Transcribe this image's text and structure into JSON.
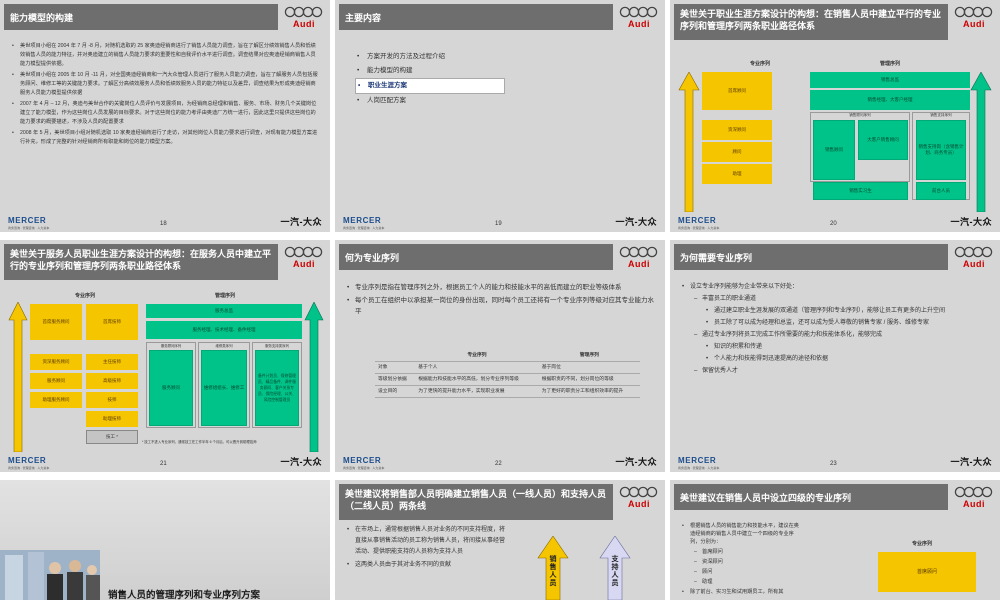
{
  "brand": {
    "mercer": "MERCER",
    "mercer_tagline": "商务咨询 · 管理咨询 · 人力资本",
    "audi": "Audi",
    "vw": "一汽-大众"
  },
  "s18": {
    "title": "能力模型的构建",
    "page": "18",
    "bullets": [
      "美世项目小组在 2004 年 7 月 -8 月，对随机选取的 25 家奥迪经销商进行了销售人员能力调查，旨在了解区分绩效销售人员和低绩效销售人员的能力特征，并对奥迪建立的销售人员能力要求的重要性和自我评价水平进行调查。调查结果对应奥迪经销商销售人员能力模型提供依据。",
      "美世项目小组在 2005 年 10 月 -11 月，对全国奥迪经销商和一汽大众管理人员进行了服务人员能力调查，旨在了解服务人员包括服务顾问、维修工等的关键能力要求。了解区分高绩效服务人员和低绩效服务人员的能力特征以及差异，调查结果为形成奥迪经销商服务人员能力模型提供依据",
      "2007 年 4 月 – 12 月，奥迪与美世合作的关键岗位人员评价与发展项目，为经销商总经理和销售、服务、市场、财务几个关键岗位建立了能力模型，作为这些岗位人员发展的目标要求。对于这些岗位的能力考评由奥迪厂方统一进行，因此这里只提供这些岗位的能力要求的概要描述，不涉及人员的配置要求",
      "2008 年 5 月，美世项目小组对随机选取 10 家奥迪经销商进行了走访，对其他岗位人员能力要求进行调查，对现有能力模型方案进行补充，形成了完整的针对经销商所有职能和岗位的能力模型方案。"
    ]
  },
  "s19": {
    "title": "主要内容",
    "page": "19",
    "items": [
      "方案开发的方法及过程介绍",
      "能力模型的构建",
      "职业生涯方案",
      "人岗匹配方案"
    ]
  },
  "s20": {
    "title": "美世关于职业生涯方案设计的构想：在销售人员中建立平行的专业序列和管理序列两条职业路径体系",
    "page": "20",
    "col_prof": "专业序列",
    "col_mgmt": "管理序列",
    "prof": [
      "首席顾问",
      "资深顾问",
      "顾问",
      "助理"
    ],
    "mgmt_top": [
      "销售总监",
      "销售经理、大客户经理"
    ],
    "grp1": "销售顾问序列",
    "grp2": "销售支持序列",
    "cells": [
      "销售顾问",
      "大客户销售顾问",
      "销售支持岗（含销售计划、商务专员）",
      "销售实习生",
      "前台人员"
    ]
  },
  "s21": {
    "title": "美世关于服务人员职业生涯方案设计的构想：在服务人员中建立平行的专业序列和管理序列两条职业路径体系",
    "page": "21",
    "col_prof": "专业序列",
    "col_mgmt": "管理序列",
    "left": [
      "首席服务顾问",
      "资深服务顾问",
      "服务顾问",
      "助理服务顾问"
    ],
    "right": [
      "首席技师",
      "主任技师",
      "高级技师",
      "技师",
      "助理技师",
      "技工 *"
    ],
    "mgmt_top": [
      "服务总监",
      "服务经理、技术经理、备件经理"
    ],
    "grp": [
      "服务顾问序列",
      "维修类序列",
      "服务支持类序列"
    ],
    "cells": [
      "服务顾问",
      "维修组组长、维修工",
      "备件计划员、保修管理员、精品备件、调件服务顾问、客户关系专员、保险经理、公关、风险控制管理员"
    ],
    "note": "* 技工不进入专业序列，通常技工在工作半年 6 个月后，可以晋升到助理技师"
  },
  "s22": {
    "title": "何为专业序列",
    "page": "22",
    "bullets": [
      "专业序列是指在管理序列之外，根据员工个人的能力和技能水平的高低而建立的职业等级体系",
      "每个员工在组织中以承担某一岗位的身份出现，同时每个员工还将有一个专业序列等级对应其专业能力水平"
    ],
    "table": {
      "headers": [
        "",
        "专业序列",
        "管理序列"
      ],
      "rows": [
        [
          "对象",
          "基于个人",
          "基于岗位"
        ],
        [
          "等级划分依据",
          "根据能力和技能水平的高低，划分专业序列等级",
          "根据职责的不同，划分岗位的等级"
        ],
        [
          "设立目的",
          "为了更快的提升能力水平，实现职业发展",
          "为了更好的职责分工和组织效率的提升"
        ]
      ]
    }
  },
  "s23": {
    "title": "为何需要专业序列",
    "page": "23",
    "lines": [
      {
        "lvl": 1,
        "t": "设立专业序列能够为企业带来以下好处："
      },
      {
        "lvl": 2,
        "t": "丰富员工的职业通道"
      },
      {
        "lvl": 3,
        "t": "通过建立职业生涯发展的双通道（管理序列和专业序列），能够让员工有更多的上升空间"
      },
      {
        "lvl": 3,
        "t": "员工除了可以成为经理和总监，还可以成为受人尊敬的销售专家 / 服务、维修专家"
      },
      {
        "lvl": 2,
        "t": "通过专业序列将员工完成工作所需要的能力和技能体系化，能够完成"
      },
      {
        "lvl": 3,
        "t": "知识的积累和传递"
      },
      {
        "lvl": 3,
        "t": "个人能力和技能得到迅速提高的途径和依据"
      },
      {
        "lvl": 2,
        "t": "保留优秀人才"
      }
    ]
  },
  "s24": {
    "title": "销售人员的管理序列和专业序列方案"
  },
  "s25": {
    "title": "美世建议将销售部人员明确建立销售人员（一线人员）和支持人员（二线人员）两条线",
    "bullets": [
      "在市场上，通常根据销售人员对业务的不同支持程度，将直接从事销售活动的员工称为销售人员，将间接从事经营活动、提供职能支持的人员称为支持人员",
      "这两类人员由于其对业务不同的贡献"
    ],
    "arrow1": "销售人员",
    "arrow2": "支持人员"
  },
  "s26": {
    "title": "美世建议在销售人员中设立四级的专业序列",
    "bullets": [
      "根据销售人员的销售能力和技能水平，建议在奥迪经销商的销售人员中建立一个四级的专业序列，分别为：",
      "除了前台、实习生和试用期员工，所有其"
    ],
    "levels": [
      "首席顾问",
      "资深顾问",
      "顾问",
      "助理"
    ],
    "col_prof": "专业序列",
    "box": "首席顾问"
  }
}
